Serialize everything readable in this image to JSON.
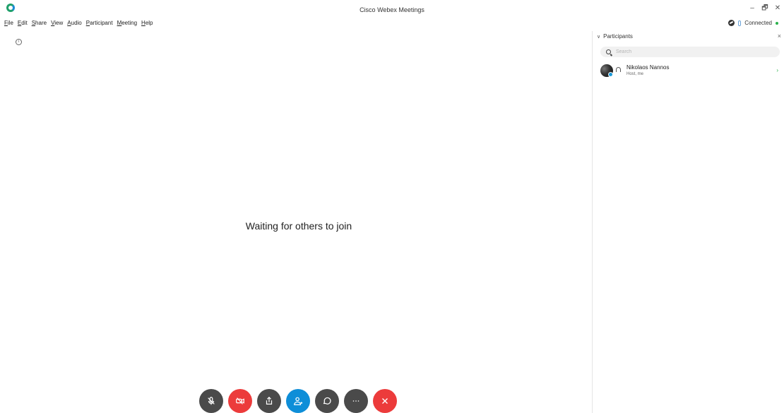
{
  "window": {
    "title": "Cisco Webex Meetings",
    "minimize": "–",
    "restore": "🗗",
    "close": "✕"
  },
  "menu": {
    "items": [
      {
        "key": "F",
        "rest": "ile"
      },
      {
        "key": "E",
        "rest": "dit"
      },
      {
        "key": "S",
        "rest": "hare"
      },
      {
        "key": "V",
        "rest": "iew"
      },
      {
        "key": "A",
        "rest": "udio"
      },
      {
        "key": "P",
        "rest": "articipant"
      },
      {
        "key": "M",
        "rest": "eeting"
      },
      {
        "key": "H",
        "rest": "elp"
      }
    ]
  },
  "status": {
    "label": "Connected",
    "dot_color": "#2bb24c"
  },
  "stage": {
    "message": "Waiting for others to join",
    "info_glyph": "i"
  },
  "controls": [
    {
      "name": "mute-button",
      "icon": "mic-off-icon",
      "color": "#4a4a4a"
    },
    {
      "name": "video-button",
      "icon": "video-off-icon",
      "color": "#ec3b3b"
    },
    {
      "name": "share-button",
      "icon": "share-icon",
      "color": "#4a4a4a"
    },
    {
      "name": "participants-button",
      "icon": "participants-icon",
      "color": "#0e8ed8"
    },
    {
      "name": "chat-button",
      "icon": "chat-icon",
      "color": "#4a4a4a"
    },
    {
      "name": "more-button",
      "icon": "more-icon",
      "color": "#4a4a4a"
    },
    {
      "name": "leave-button",
      "icon": "close-icon",
      "color": "#ec3b3b"
    }
  ],
  "panel": {
    "title": "Participants",
    "close": "×",
    "search_placeholder": "Search",
    "participants": [
      {
        "name": "Nikolaos Nannos",
        "role": "Host, me"
      }
    ]
  },
  "colors": {
    "accent_blue": "#0e8ed8",
    "danger_red": "#ec3b3b",
    "control_dark": "#4a4a4a"
  }
}
